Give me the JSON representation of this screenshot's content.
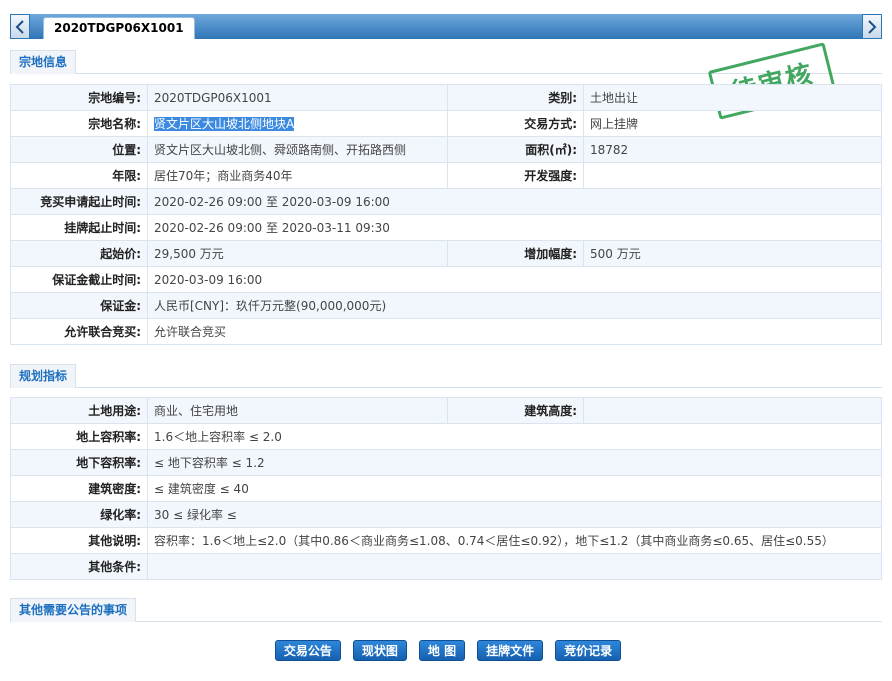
{
  "tab": {
    "label": "2020TDGP06X1001"
  },
  "stamp": "待审核",
  "sections": {
    "info": "宗地信息",
    "plan": "规划指标",
    "other": "其他需要公告的事项"
  },
  "parcel": {
    "code_label": "宗地编号:",
    "code": "2020TDGP06X1001",
    "type_label": "类别:",
    "type": "土地出让",
    "name_label": "宗地名称:",
    "name": "贤文片区大山坡北侧地块A",
    "trade_label": "交易方式:",
    "trade": "网上挂牌",
    "loc_label": "位置:",
    "loc": "贤文片区大山坡北侧、舜颂路南侧、开拓路西侧",
    "area_label": "面积(㎡):",
    "area": "18782",
    "years_label": "年限:",
    "years": "居住70年；商业商务40年",
    "dev_label": "开发强度:",
    "dev": "",
    "apply_label": "竞买申请起止时间:",
    "apply": "2020-02-26 09:00 至 2020-03-09 16:00",
    "list_label": "挂牌起止时间:",
    "list": "2020-02-26 09:00 至 2020-03-11 09:30",
    "start_label": "起始价:",
    "start": "29,500 万元",
    "inc_label": "增加幅度:",
    "inc": "500 万元",
    "deposit_deadline_label": "保证金截止时间:",
    "deposit_deadline": "2020-03-09 16:00",
    "deposit_label": "保证金:",
    "deposit": "人民币[CNY]：玖仟万元整(90,000,000元)",
    "joint_label": "允许联合竞买:",
    "joint": "允许联合竞买"
  },
  "plan": {
    "use_label": "土地用途:",
    "use": "商业、住宅用地",
    "height_label": "建筑高度:",
    "height": "",
    "far_label": "地上容积率:",
    "far": "1.6＜地上容积率 ≤ 2.0",
    "ufar_label": "地下容积率:",
    "ufar": "≤ 地下容积率 ≤ 1.2",
    "density_label": "建筑密度:",
    "density": "≤ 建筑密度 ≤ 40",
    "green_label": "绿化率:",
    "green": "30 ≤ 绿化率 ≤",
    "notes_label": "其他说明:",
    "notes": "容积率：1.6＜地上≤2.0（其中0.86＜商业商务≤1.08、0.74＜居住≤0.92），地下≤1.2（其中商业商务≤0.65、居住≤0.55）",
    "cond_label": "其他条件:",
    "cond": ""
  },
  "buttons": {
    "notice": "交易公告",
    "status": "现状图",
    "map": "地 图",
    "docs": "挂牌文件",
    "bids": "竞价记录"
  }
}
